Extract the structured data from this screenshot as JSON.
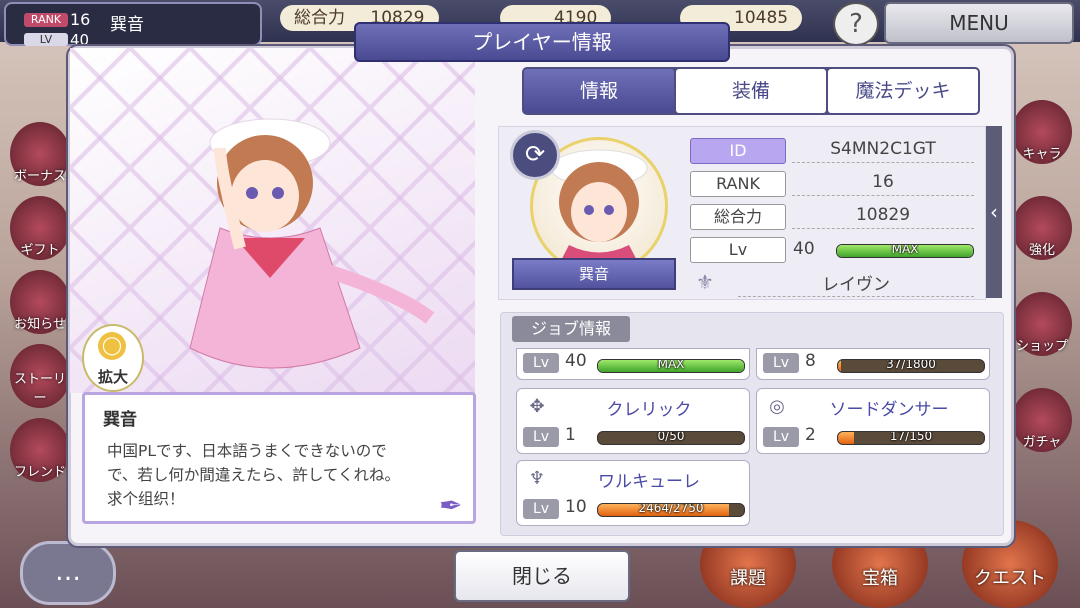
{
  "hud": {
    "rank_badge": "RANK",
    "rank": "16",
    "lv_badge": "LV",
    "lv": "40",
    "player_name": "巽音",
    "total_power_label": "総合力",
    "total_power": "10829",
    "currency1": "4190",
    "currency2": "10485",
    "help": "?",
    "menu": "MENU"
  },
  "side_buttons": [
    "ボーナス",
    "ギフト",
    "お知らせ",
    "ストーリー",
    "フレンド"
  ],
  "right_buttons": [
    "キャラ",
    "強化",
    "ショップ",
    "ガチャ"
  ],
  "bottom_buttons": [
    "課題",
    "宝箱",
    "クエスト"
  ],
  "dialog": {
    "title": "プレイヤー情報",
    "tabs": [
      "情報",
      "装備",
      "魔法デッキ"
    ],
    "zoom_label": "拡大",
    "profile": {
      "name": "巽音",
      "message": "中国PLです、日本語うまくできないので\nで、若し何か間違えたら、許してくれね。\n求个组织！"
    },
    "info": {
      "ribbon_name": "巽音",
      "id_label": "ID",
      "id_value": "S4MN2C1GT",
      "rank_label": "RANK",
      "rank_value": "16",
      "power_label": "総合力",
      "power_value": "10829",
      "lv_label": "Lv",
      "lv_value": "40",
      "lv_bar_text": "MAX",
      "guild_name": "レイヴン"
    },
    "jobs_title": "ジョブ情報",
    "jobs_partial": [
      {
        "lv_label": "Lv",
        "lv": "40",
        "bar_text": "MAX",
        "fill": 1.0,
        "color": "green"
      },
      {
        "lv_label": "Lv",
        "lv": "8",
        "bar_text": "37/1800",
        "fill": 0.02,
        "color": "orange"
      }
    ],
    "jobs": [
      {
        "name": "クレリック",
        "icon": "cross-icon",
        "lv_label": "Lv",
        "lv": "1",
        "bar_text": "0/50",
        "fill": 0.0,
        "color": "orange"
      },
      {
        "name": "ソードダンサー",
        "icon": "swirl-icon",
        "lv_label": "Lv",
        "lv": "2",
        "bar_text": "17/150",
        "fill": 0.11,
        "color": "orange"
      },
      {
        "name": "ワルキューレ",
        "icon": "valkyrie-icon",
        "lv_label": "Lv",
        "lv": "10",
        "bar_text": "2464/2750",
        "fill": 0.9,
        "color": "orange"
      }
    ],
    "close_label": "閉じる"
  }
}
